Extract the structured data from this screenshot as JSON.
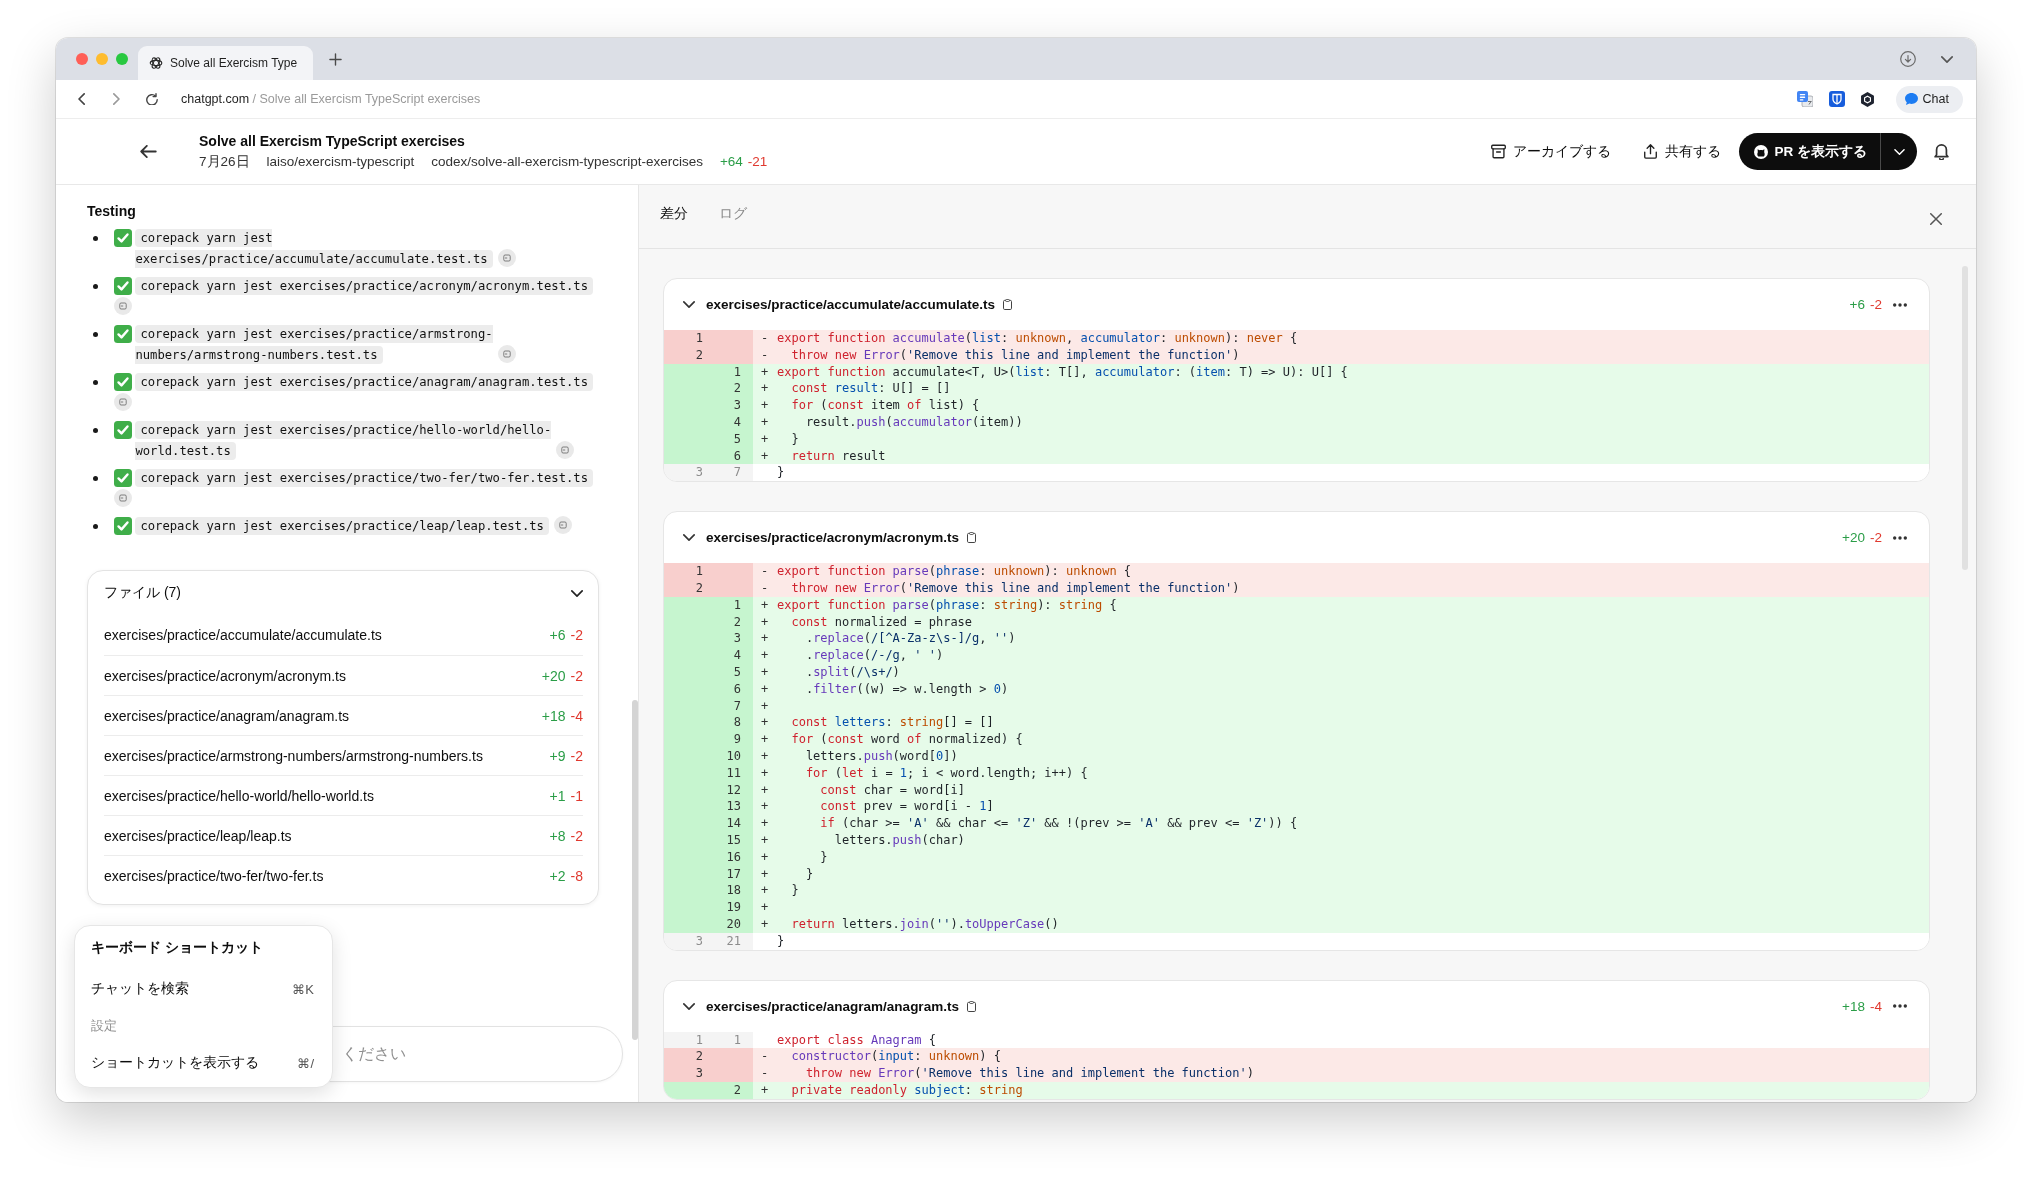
{
  "browser": {
    "tab_title": "Solve all Exercism Type",
    "url_domain": "chatgpt.com",
    "url_path": "/ Solve all Exercism TypeScript exercises",
    "chat_button": "Chat"
  },
  "header": {
    "title": "Solve all Exercism TypeScript exercises",
    "date": "7月26日",
    "repository": "laiso/exercism-typescript",
    "branch": "codex/solve-all-exercism-typescript-exercises",
    "additions": "+64",
    "deletions": "-21",
    "actions": [
      {
        "kind": "archive",
        "label": "アーカイブする"
      },
      {
        "kind": "share",
        "label": "共有する"
      }
    ],
    "pr_button": "PR を表示する"
  },
  "testing": {
    "title": "Testing",
    "items": [
      {
        "command": "corepack yarn jest exercises/practice/accumulate/accumulate.test.ts",
        "passed": true
      },
      {
        "command": "corepack yarn jest exercises/practice/acronym/acronym.test.ts",
        "passed": true
      },
      {
        "command": "corepack yarn jest exercises/practice/armstrong-numbers/armstrong-numbers.test.ts",
        "passed": true
      },
      {
        "command": "corepack yarn jest exercises/practice/anagram/anagram.test.ts",
        "passed": true
      },
      {
        "command": "corepack yarn jest exercises/practice/hello-world/hello-world.test.ts",
        "passed": true
      },
      {
        "command": "corepack yarn jest exercises/practice/two-fer/two-fer.test.ts",
        "passed": true
      },
      {
        "command": "corepack yarn jest exercises/practice/leap/leap.test.ts",
        "passed": true
      }
    ]
  },
  "files": {
    "title": "ファイル (7)",
    "expanded": true,
    "rows": [
      {
        "path": "exercises/practice/accumulate/accumulate.ts",
        "additions": "+6",
        "deletions": "-2"
      },
      {
        "path": "exercises/practice/acronym/acronym.ts",
        "additions": "+20",
        "deletions": "-2"
      },
      {
        "path": "exercises/practice/anagram/anagram.ts",
        "additions": "+18",
        "deletions": "-4"
      },
      {
        "path": "exercises/practice/armstrong-numbers/armstrong-numbers.ts",
        "additions": "+9",
        "deletions": "-2"
      },
      {
        "path": "exercises/practice/hello-world/hello-world.ts",
        "additions": "+1",
        "deletions": "-1"
      },
      {
        "path": "exercises/practice/leap/leap.ts",
        "additions": "+8",
        "deletions": "-2"
      },
      {
        "path": "exercises/practice/two-fer/two-fer.ts",
        "additions": "+2",
        "deletions": "-8"
      }
    ]
  },
  "shortcuts": {
    "title": "キーボード ショートカット",
    "items": [
      {
        "kind": "shortcut",
        "label": "チャットを検索",
        "keys": "⌘K"
      },
      {
        "kind": "section",
        "label": "設定"
      },
      {
        "kind": "shortcut",
        "label": "ショートカットを表示する",
        "keys": "⌘/"
      }
    ]
  },
  "composer": {
    "placeholder": "ください"
  },
  "panel": {
    "tabs": [
      {
        "label": "差分",
        "selected": true
      },
      {
        "label": "ログ",
        "selected": false
      }
    ],
    "diffs": [
      {
        "path": "exercises/practice/accumulate/accumulate.ts",
        "additions": "+6",
        "deletions": "-2",
        "expanded": true,
        "lines": [
          {
            "kind": "removed",
            "old": "1",
            "sign": "-",
            "segments": [
              {
                "kind": "keyword",
                "text": "export function "
              },
              {
                "kind": "function",
                "text": "accumulate"
              },
              {
                "kind": "plain",
                "text": "("
              },
              {
                "kind": "variable",
                "text": "list"
              },
              {
                "kind": "plain",
                "text": ": "
              },
              {
                "kind": "type",
                "text": "unknown"
              },
              {
                "kind": "plain",
                "text": ", "
              },
              {
                "kind": "variable",
                "text": "accumulator"
              },
              {
                "kind": "plain",
                "text": ": "
              },
              {
                "kind": "type",
                "text": "unknown"
              },
              {
                "kind": "plain",
                "text": "): "
              },
              {
                "kind": "type",
                "text": "never"
              },
              {
                "kind": "plain",
                "text": " {"
              }
            ]
          },
          {
            "kind": "removed",
            "old": "2",
            "sign": "-",
            "segments": [
              {
                "kind": "keyword",
                "text": "  throw new "
              },
              {
                "kind": "function",
                "text": "Error"
              },
              {
                "kind": "plain",
                "text": "("
              },
              {
                "kind": "string",
                "text": "'Remove this line and implement the function'"
              },
              {
                "kind": "plain",
                "text": ")"
              }
            ]
          },
          {
            "kind": "added",
            "new": "1",
            "sign": "+",
            "segments": [
              {
                "kind": "keyword",
                "text": "export function "
              },
              {
                "kind": "plain",
                "text": "accumulate<T, U>("
              },
              {
                "kind": "variable",
                "text": "list"
              },
              {
                "kind": "plain",
                "text": ": T[], "
              },
              {
                "kind": "variable",
                "text": "accumulator"
              },
              {
                "kind": "plain",
                "text": ": ("
              },
              {
                "kind": "variable",
                "text": "item"
              },
              {
                "kind": "plain",
                "text": ": T) => U): U[] {"
              }
            ]
          },
          {
            "kind": "added",
            "new": "2",
            "sign": "+",
            "segments": [
              {
                "kind": "keyword",
                "text": "  const "
              },
              {
                "kind": "variable",
                "text": "result"
              },
              {
                "kind": "plain",
                "text": ": U[] = []"
              }
            ]
          },
          {
            "kind": "added",
            "new": "3",
            "sign": "+",
            "segments": [
              {
                "kind": "keyword",
                "text": "  for"
              },
              {
                "kind": "plain",
                "text": " ("
              },
              {
                "kind": "keyword",
                "text": "const"
              },
              {
                "kind": "plain",
                "text": " item "
              },
              {
                "kind": "keyword",
                "text": "of"
              },
              {
                "kind": "plain",
                "text": " list) {"
              }
            ]
          },
          {
            "kind": "added",
            "new": "4",
            "sign": "+",
            "segments": [
              {
                "kind": "plain",
                "text": "    result."
              },
              {
                "kind": "function",
                "text": "push"
              },
              {
                "kind": "plain",
                "text": "("
              },
              {
                "kind": "function",
                "text": "accumulator"
              },
              {
                "kind": "plain",
                "text": "(item))"
              }
            ]
          },
          {
            "kind": "added",
            "new": "5",
            "sign": "+",
            "segments": [
              {
                "kind": "plain",
                "text": "  }"
              }
            ]
          },
          {
            "kind": "added",
            "new": "6",
            "sign": "+",
            "segments": [
              {
                "kind": "keyword",
                "text": "  return"
              },
              {
                "kind": "plain",
                "text": " result"
              }
            ]
          },
          {
            "kind": "context",
            "old": "3",
            "new": "7",
            "segments": [
              {
                "kind": "plain",
                "text": "}"
              }
            ]
          }
        ]
      },
      {
        "path": "exercises/practice/acronym/acronym.ts",
        "additions": "+20",
        "deletions": "-2",
        "expanded": true,
        "lines": [
          {
            "kind": "removed",
            "old": "1",
            "sign": "-",
            "segments": [
              {
                "kind": "keyword",
                "text": "export function "
              },
              {
                "kind": "function",
                "text": "parse"
              },
              {
                "kind": "plain",
                "text": "("
              },
              {
                "kind": "variable",
                "text": "phrase"
              },
              {
                "kind": "plain",
                "text": ": "
              },
              {
                "kind": "type",
                "text": "unknown"
              },
              {
                "kind": "plain",
                "text": "): "
              },
              {
                "kind": "type",
                "text": "unknown"
              },
              {
                "kind": "plain",
                "text": " {"
              }
            ]
          },
          {
            "kind": "removed",
            "old": "2",
            "sign": "-",
            "segments": [
              {
                "kind": "keyword",
                "text": "  throw new "
              },
              {
                "kind": "function",
                "text": "Error"
              },
              {
                "kind": "plain",
                "text": "("
              },
              {
                "kind": "string",
                "text": "'Remove this line and implement the function'"
              },
              {
                "kind": "plain",
                "text": ")"
              }
            ]
          },
          {
            "kind": "added",
            "new": "1",
            "sign": "+",
            "segments": [
              {
                "kind": "keyword",
                "text": "export function "
              },
              {
                "kind": "function",
                "text": "parse"
              },
              {
                "kind": "plain",
                "text": "("
              },
              {
                "kind": "variable",
                "text": "phrase"
              },
              {
                "kind": "plain",
                "text": ": "
              },
              {
                "kind": "type",
                "text": "string"
              },
              {
                "kind": "plain",
                "text": "): "
              },
              {
                "kind": "type",
                "text": "string"
              },
              {
                "kind": "plain",
                "text": " {"
              }
            ]
          },
          {
            "kind": "added",
            "new": "2",
            "sign": "+",
            "segments": [
              {
                "kind": "keyword",
                "text": "  const"
              },
              {
                "kind": "plain",
                "text": " normalized = phrase"
              }
            ]
          },
          {
            "kind": "added",
            "new": "3",
            "sign": "+",
            "segments": [
              {
                "kind": "plain",
                "text": "    ."
              },
              {
                "kind": "function",
                "text": "replace"
              },
              {
                "kind": "plain",
                "text": "("
              },
              {
                "kind": "string",
                "text": "/[^A-Za-z\\s-]/g"
              },
              {
                "kind": "plain",
                "text": ", "
              },
              {
                "kind": "string",
                "text": "''"
              },
              {
                "kind": "plain",
                "text": ")"
              }
            ]
          },
          {
            "kind": "added",
            "new": "4",
            "sign": "+",
            "segments": [
              {
                "kind": "plain",
                "text": "    ."
              },
              {
                "kind": "function",
                "text": "replace"
              },
              {
                "kind": "plain",
                "text": "("
              },
              {
                "kind": "string",
                "text": "/-/g"
              },
              {
                "kind": "plain",
                "text": ", "
              },
              {
                "kind": "string",
                "text": "' '"
              },
              {
                "kind": "plain",
                "text": ")"
              }
            ]
          },
          {
            "kind": "added",
            "new": "5",
            "sign": "+",
            "segments": [
              {
                "kind": "plain",
                "text": "    ."
              },
              {
                "kind": "function",
                "text": "split"
              },
              {
                "kind": "plain",
                "text": "("
              },
              {
                "kind": "string",
                "text": "/\\s+/"
              },
              {
                "kind": "plain",
                "text": ")"
              }
            ]
          },
          {
            "kind": "added",
            "new": "6",
            "sign": "+",
            "segments": [
              {
                "kind": "plain",
                "text": "    ."
              },
              {
                "kind": "function",
                "text": "filter"
              },
              {
                "kind": "plain",
                "text": "((w) => w.length > "
              },
              {
                "kind": "number",
                "text": "0"
              },
              {
                "kind": "plain",
                "text": ")"
              }
            ]
          },
          {
            "kind": "added",
            "new": "7",
            "sign": "+"
          },
          {
            "kind": "added",
            "new": "8",
            "sign": "+",
            "segments": [
              {
                "kind": "keyword",
                "text": "  const "
              },
              {
                "kind": "variable",
                "text": "letters"
              },
              {
                "kind": "plain",
                "text": ": "
              },
              {
                "kind": "type",
                "text": "string"
              },
              {
                "kind": "plain",
                "text": "[] = []"
              }
            ]
          },
          {
            "kind": "added",
            "new": "9",
            "sign": "+",
            "segments": [
              {
                "kind": "keyword",
                "text": "  for"
              },
              {
                "kind": "plain",
                "text": " ("
              },
              {
                "kind": "keyword",
                "text": "const"
              },
              {
                "kind": "plain",
                "text": " word "
              },
              {
                "kind": "keyword",
                "text": "of"
              },
              {
                "kind": "plain",
                "text": " normalized) {"
              }
            ]
          },
          {
            "kind": "added",
            "new": "10",
            "sign": "+",
            "segments": [
              {
                "kind": "plain",
                "text": "    letters."
              },
              {
                "kind": "function",
                "text": "push"
              },
              {
                "kind": "plain",
                "text": "(word["
              },
              {
                "kind": "number",
                "text": "0"
              },
              {
                "kind": "plain",
                "text": "])"
              }
            ]
          },
          {
            "kind": "added",
            "new": "11",
            "sign": "+",
            "segments": [
              {
                "kind": "keyword",
                "text": "    for"
              },
              {
                "kind": "plain",
                "text": " ("
              },
              {
                "kind": "keyword",
                "text": "let"
              },
              {
                "kind": "plain",
                "text": " i = "
              },
              {
                "kind": "number",
                "text": "1"
              },
              {
                "kind": "plain",
                "text": "; i < word.length; i++) {"
              }
            ]
          },
          {
            "kind": "added",
            "new": "12",
            "sign": "+",
            "segments": [
              {
                "kind": "keyword",
                "text": "      const"
              },
              {
                "kind": "plain",
                "text": " char = word[i]"
              }
            ]
          },
          {
            "kind": "added",
            "new": "13",
            "sign": "+",
            "segments": [
              {
                "kind": "keyword",
                "text": "      const"
              },
              {
                "kind": "plain",
                "text": " prev = word[i - "
              },
              {
                "kind": "number",
                "text": "1"
              },
              {
                "kind": "plain",
                "text": "]"
              }
            ]
          },
          {
            "kind": "added",
            "new": "14",
            "sign": "+",
            "segments": [
              {
                "kind": "keyword",
                "text": "      if"
              },
              {
                "kind": "plain",
                "text": " (char >= "
              },
              {
                "kind": "string",
                "text": "'A'"
              },
              {
                "kind": "plain",
                "text": " && char <= "
              },
              {
                "kind": "string",
                "text": "'Z'"
              },
              {
                "kind": "plain",
                "text": " && !(prev >= "
              },
              {
                "kind": "string",
                "text": "'A'"
              },
              {
                "kind": "plain",
                "text": " && prev <= "
              },
              {
                "kind": "string",
                "text": "'Z'"
              },
              {
                "kind": "plain",
                "text": ")) {"
              }
            ]
          },
          {
            "kind": "added",
            "new": "15",
            "sign": "+",
            "segments": [
              {
                "kind": "plain",
                "text": "        letters."
              },
              {
                "kind": "function",
                "text": "push"
              },
              {
                "kind": "plain",
                "text": "(char)"
              }
            ]
          },
          {
            "kind": "added",
            "new": "16",
            "sign": "+",
            "segments": [
              {
                "kind": "plain",
                "text": "      }"
              }
            ]
          },
          {
            "kind": "added",
            "new": "17",
            "sign": "+",
            "segments": [
              {
                "kind": "plain",
                "text": "    }"
              }
            ]
          },
          {
            "kind": "added",
            "new": "18",
            "sign": "+",
            "segments": [
              {
                "kind": "plain",
                "text": "  }"
              }
            ]
          },
          {
            "kind": "added",
            "new": "19",
            "sign": "+"
          },
          {
            "kind": "added",
            "new": "20",
            "sign": "+",
            "segments": [
              {
                "kind": "keyword",
                "text": "  return"
              },
              {
                "kind": "plain",
                "text": " letters."
              },
              {
                "kind": "function",
                "text": "join"
              },
              {
                "kind": "plain",
                "text": "("
              },
              {
                "kind": "string",
                "text": "''"
              },
              {
                "kind": "plain",
                "text": ")."
              },
              {
                "kind": "function",
                "text": "toUpperCase"
              },
              {
                "kind": "plain",
                "text": "()"
              }
            ]
          },
          {
            "kind": "context",
            "old": "3",
            "new": "21",
            "segments": [
              {
                "kind": "plain",
                "text": "}"
              }
            ]
          }
        ]
      },
      {
        "path": "exercises/practice/anagram/anagram.ts",
        "additions": "+18",
        "deletions": "-4",
        "expanded": true,
        "lines": [
          {
            "kind": "context",
            "old": "1",
            "new": "1",
            "segments": [
              {
                "kind": "keyword",
                "text": "export class "
              },
              {
                "kind": "function",
                "text": "Anagram"
              },
              {
                "kind": "plain",
                "text": " {"
              }
            ]
          },
          {
            "kind": "removed",
            "old": "2",
            "sign": "-",
            "segments": [
              {
                "kind": "function",
                "text": "  constructor"
              },
              {
                "kind": "plain",
                "text": "("
              },
              {
                "kind": "variable",
                "text": "input"
              },
              {
                "kind": "plain",
                "text": ": "
              },
              {
                "kind": "type",
                "text": "unknown"
              },
              {
                "kind": "plain",
                "text": ") {"
              }
            ]
          },
          {
            "kind": "removed",
            "old": "3",
            "sign": "-",
            "segments": [
              {
                "kind": "keyword",
                "text": "    throw new "
              },
              {
                "kind": "function",
                "text": "Error"
              },
              {
                "kind": "plain",
                "text": "("
              },
              {
                "kind": "string",
                "text": "'Remove this line and implement the function'"
              },
              {
                "kind": "plain",
                "text": ")"
              }
            ]
          },
          {
            "kind": "added",
            "new": "2",
            "sign": "+",
            "segments": [
              {
                "kind": "keyword",
                "text": "  private readonly "
              },
              {
                "kind": "variable",
                "text": "subject"
              },
              {
                "kind": "plain",
                "text": ": "
              },
              {
                "kind": "type",
                "text": "string"
              }
            ]
          }
        ]
      }
    ]
  }
}
